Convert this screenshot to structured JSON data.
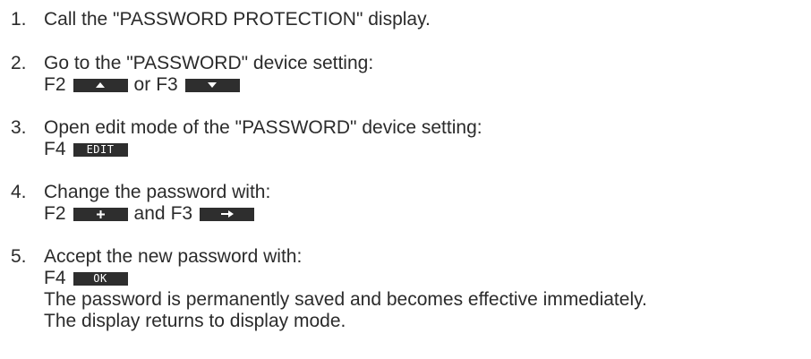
{
  "steps": [
    {
      "number": "1.",
      "text": "Call the \"PASSWORD PROTECTION\" display."
    },
    {
      "number": "2.",
      "text": "Go to the \"PASSWORD\" device setting:",
      "keys_line": {
        "key1": "F2",
        "icon1": "up-arrow-icon",
        "between": "or",
        "key2": "F3",
        "icon2": "down-arrow-icon"
      }
    },
    {
      "number": "3.",
      "text": "Open edit mode of the \"PASSWORD\" device setting:",
      "keys_line": {
        "key1": "F4",
        "softkey_label": "EDIT"
      }
    },
    {
      "number": "4.",
      "text": "Change the password with:",
      "keys_line": {
        "key1": "F2",
        "icon1": "plus-icon",
        "between": "and",
        "key2": "F3",
        "icon2": "right-arrow-icon"
      }
    },
    {
      "number": "5.",
      "text": "Accept the new password with:",
      "keys_line": {
        "key1": "F4",
        "softkey_label": "OK"
      },
      "note_1": "The password is permanently saved and becomes effective immediately.",
      "note_2": "The display returns to display mode."
    }
  ],
  "colors": {
    "text": "#2b2b2b",
    "softkey_background": "#2e2e2e",
    "softkey_foreground": "#ffffff"
  }
}
